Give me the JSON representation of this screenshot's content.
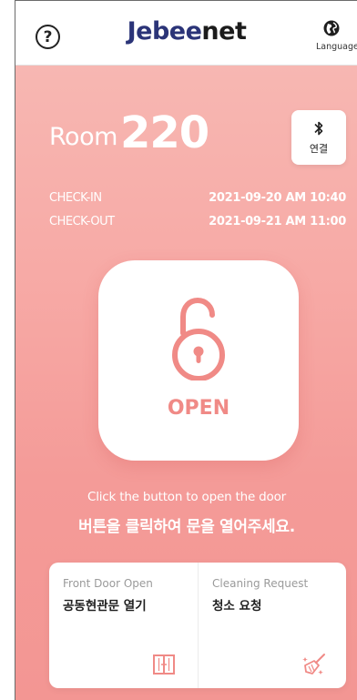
{
  "header": {
    "help_symbol": "?",
    "brand_part1": "Jebee",
    "brand_part2": "net",
    "language_label": "Language"
  },
  "room": {
    "label": "Room",
    "number": "220"
  },
  "bluetooth": {
    "label": "연결"
  },
  "stay": {
    "checkin_label": "CHECK-IN",
    "checkin_value": "2021-09-20 AM 10:40",
    "checkout_label": "CHECK-OUT",
    "checkout_value": "2021-09-21 AM 11:00"
  },
  "open_button": {
    "label": "OPEN"
  },
  "hint": {
    "en": "Click the button to open the door",
    "ko": "버튼을 클릭하여 문을 열어주세요."
  },
  "actions": [
    {
      "en": "Front Door Open",
      "ko": "공동현관문 열기",
      "icon": "door-icon"
    },
    {
      "en": "Cleaning Request",
      "ko": "청소 요청",
      "icon": "broom-icon"
    }
  ],
  "colors": {
    "brand_primary": "#2b3478",
    "brand_secondary": "#1b1b1b",
    "accent": "#f08a86",
    "gradient_top": "#f7b7b2",
    "gradient_bottom": "#f39693"
  }
}
